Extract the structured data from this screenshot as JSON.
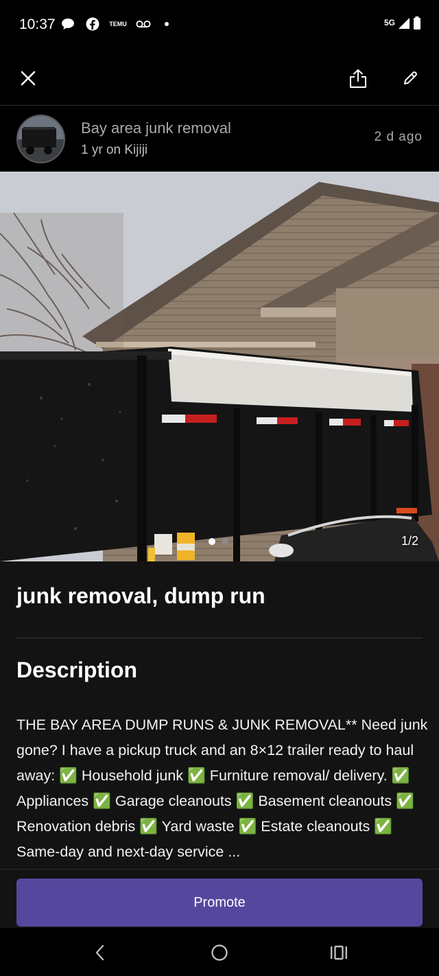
{
  "status_bar": {
    "time": "10:37",
    "notification_icons": [
      "chat-bubble-icon",
      "facebook-icon",
      "temu-icon",
      "voicemail-icon"
    ],
    "temu_label": "TEMU",
    "network": "5G",
    "signal_icon": "signal-icon",
    "battery_icon": "battery-icon"
  },
  "top_bar": {
    "close_icon": "close-icon",
    "share_icon": "share-icon",
    "edit_icon": "pencil-icon"
  },
  "seller": {
    "name": "Bay area junk removal",
    "membership": "1 yr on Kijiji",
    "posted": "2 d  ago"
  },
  "photo": {
    "counter": "1/2",
    "total_images": 2,
    "current_index": 1
  },
  "listing": {
    "title": "junk removal, dump run",
    "description_heading": "Description",
    "description": "THE BAY AREA DUMP RUNS & JUNK REMOVAL** Need junk gone? I have a pickup truck and an 8×12 trailer ready to haul away: ✅ Household junk ✅ Furniture removal/ delivery. ✅ Appliances ✅ Garage cleanouts ✅ Basement cleanouts ✅ Renovation debris ✅ Yard waste ✅ Estate cleanouts ✅ Same-day and next-day service ..."
  },
  "actions": {
    "promote_label": "Promote",
    "promote_color": "#56479e"
  },
  "nav_bar": {
    "back_icon": "back-icon",
    "home_icon": "home-icon",
    "recents_icon": "recents-icon"
  }
}
